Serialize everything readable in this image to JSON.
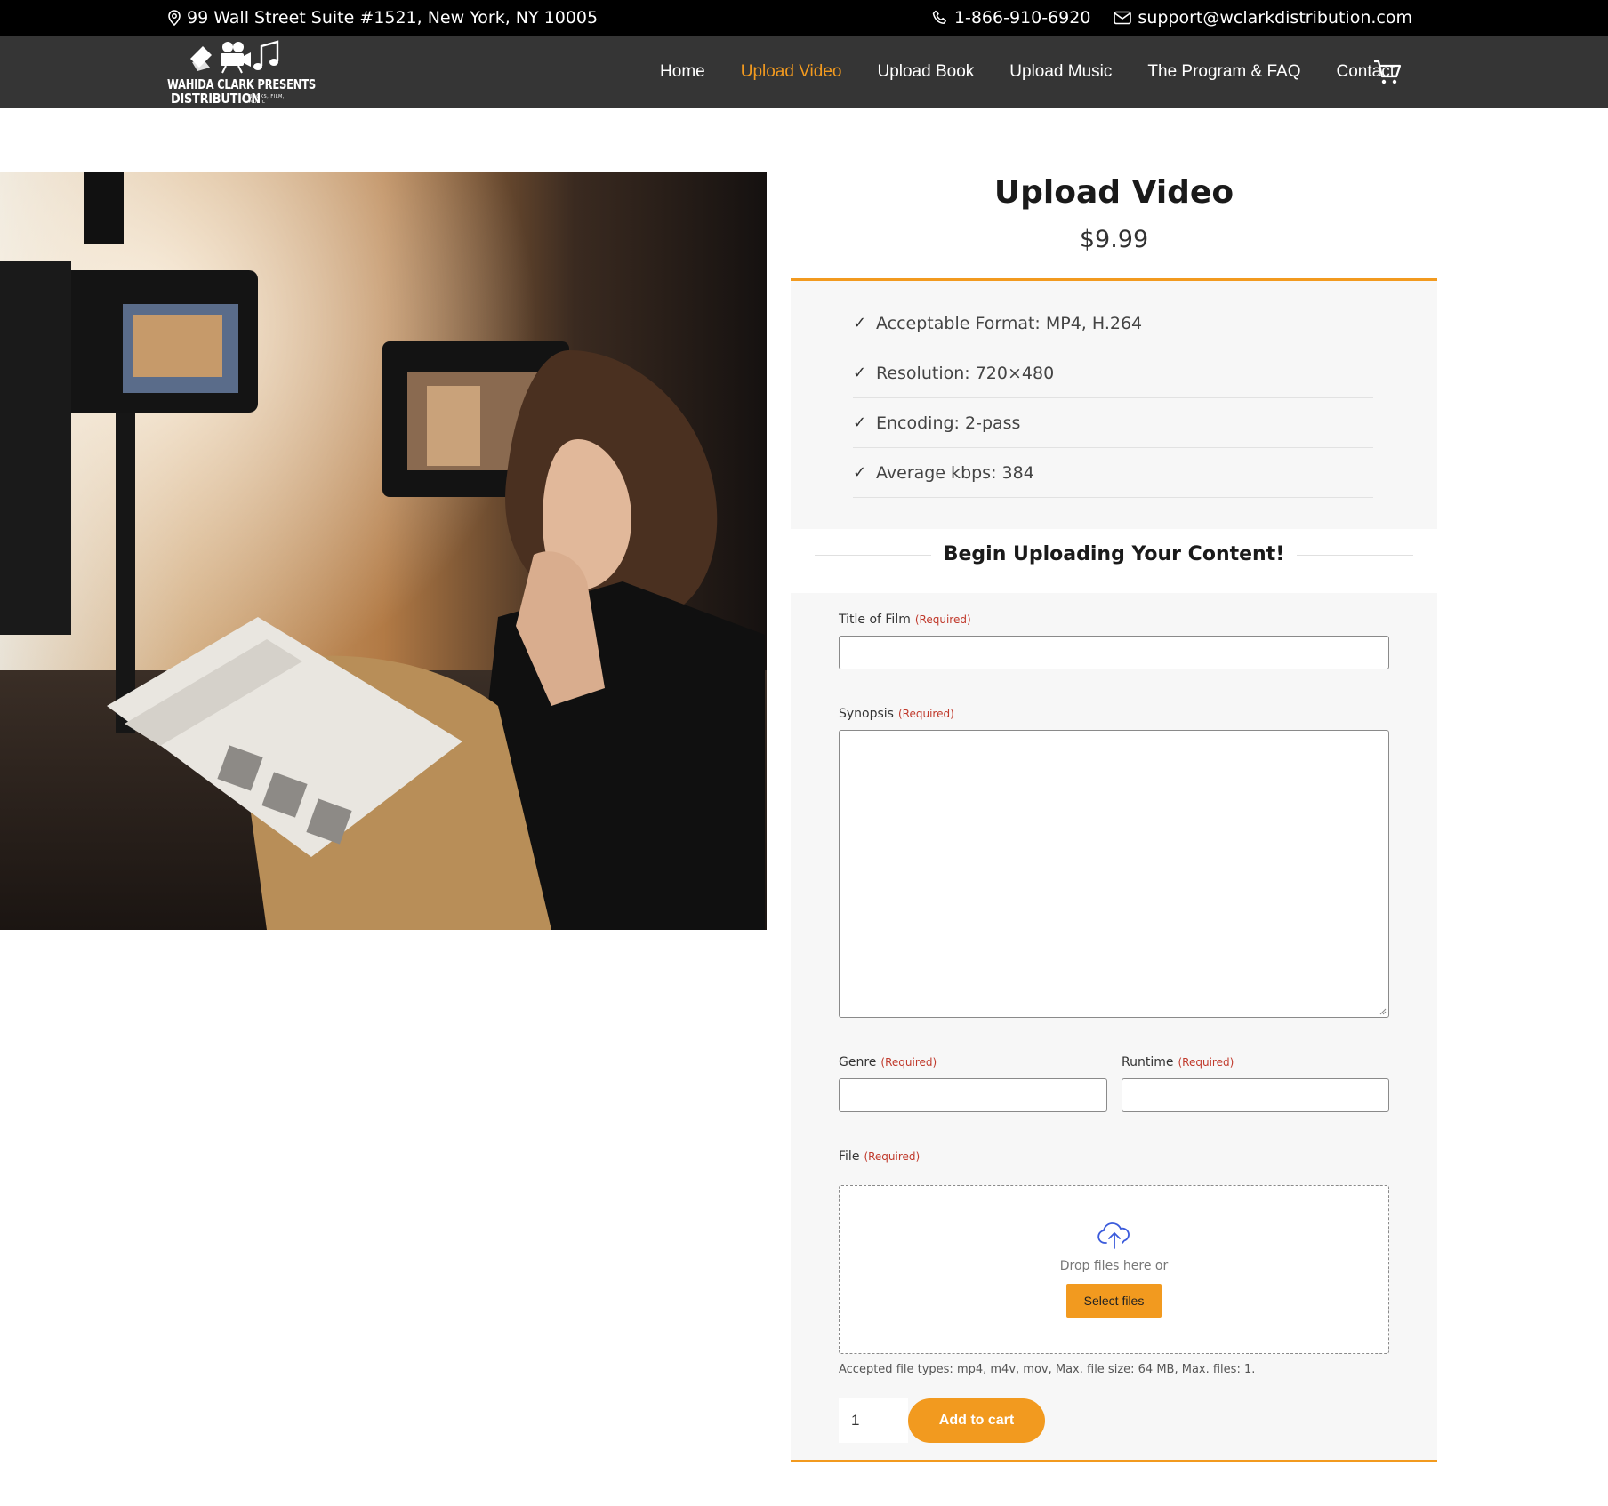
{
  "topbar": {
    "address": "99 Wall Street Suite #1521, New York, NY 10005",
    "phone": "1-866-910-6920",
    "email": "support@wclarkdistribution.com"
  },
  "logo": {
    "line1": "WAHIDA CLARK PRESENTS",
    "line2": "DISTRIBUTION",
    "tagline": "BOOKS, FILM, MUSIC"
  },
  "nav": {
    "items": [
      {
        "label": "Home",
        "active": false
      },
      {
        "label": "Upload Video",
        "active": true
      },
      {
        "label": "Upload Book",
        "active": false
      },
      {
        "label": "Upload Music",
        "active": false
      },
      {
        "label": "The Program & FAQ",
        "active": false
      },
      {
        "label": "Contact",
        "active": false
      }
    ],
    "cart_icon": "cart-icon"
  },
  "product": {
    "title": "Upload Video",
    "price": "$9.99",
    "specs": [
      "Acceptable Format: MP4, H.264",
      "Resolution: 720×480",
      "Encoding: 2-pass",
      "Average kbps: 384"
    ],
    "section_heading": "Begin Uploading Your Content!"
  },
  "form": {
    "required_text": "(Required)",
    "title_label": "Title of Film",
    "title_value": "",
    "synopsis_label": "Synopsis",
    "synopsis_value": "",
    "genre_label": "Genre",
    "genre_value": "",
    "runtime_label": "Runtime",
    "runtime_value": "",
    "file_label": "File",
    "drop_text": "Drop files here or",
    "select_files": "Select files",
    "accepted_hint": "Accepted file types: mp4, m4v, mov, Max. file size: 64 MB, Max. files: 1.",
    "quantity": "1",
    "add_to_cart": "Add to cart"
  },
  "colors": {
    "accent": "#f29a1f",
    "topbar_bg": "#000000",
    "navbar_bg": "#353535",
    "required": "#c0392b"
  }
}
